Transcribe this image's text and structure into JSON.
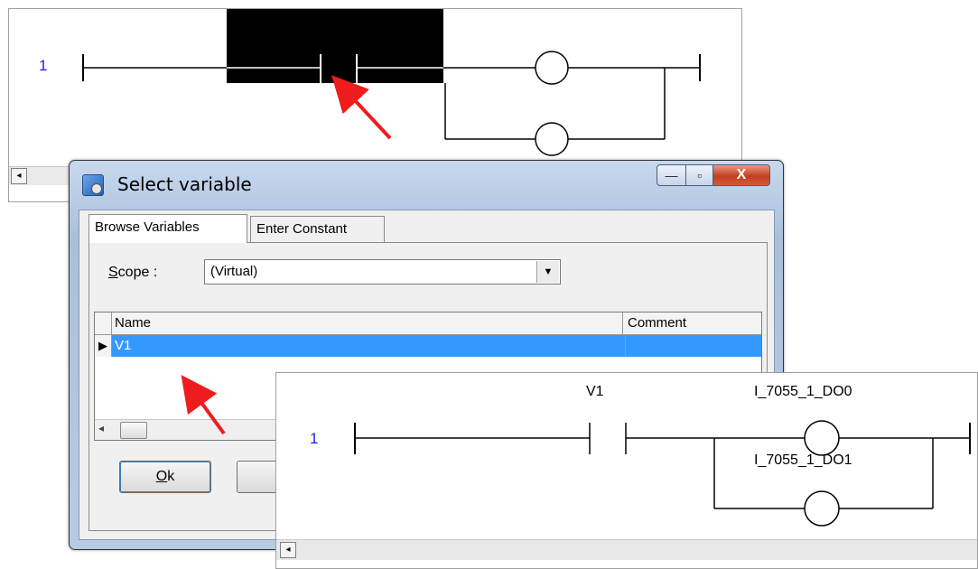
{
  "top_ladder": {
    "rung_number": "1",
    "scroll_left_glyph": "◂"
  },
  "dialog": {
    "title": "Select variable",
    "window_buttons": {
      "minimize": "—",
      "maximize": "▫",
      "close": "X"
    },
    "tabs": [
      {
        "label": "Browse Variables",
        "active": true
      },
      {
        "label": "Enter Constant",
        "active": false
      }
    ],
    "scope": {
      "label_prefix": "S",
      "label_rest": "cope :",
      "value": "(Virtual)",
      "arrow": "▼"
    },
    "grid": {
      "columns": [
        "Name",
        "Comment"
      ],
      "rows": [
        {
          "indicator": "▶",
          "name": "V1",
          "comment": ""
        }
      ],
      "scroll_left": "◂"
    },
    "buttons": {
      "ok_prefix": "O",
      "ok_rest": "k",
      "cancel": ""
    }
  },
  "bottom_ladder": {
    "rung_number": "1",
    "contact_variable": "V1",
    "coil_1": "I_7055_1_DO0",
    "coil_2": "I_7055_1_DO1",
    "scroll_left_glyph": "◂"
  },
  "colors": {
    "selection_blue": "#3399ff",
    "rung_number": "#1a1aff",
    "arrow_red": "#ee1c1c",
    "highlight_block": "#000000"
  }
}
